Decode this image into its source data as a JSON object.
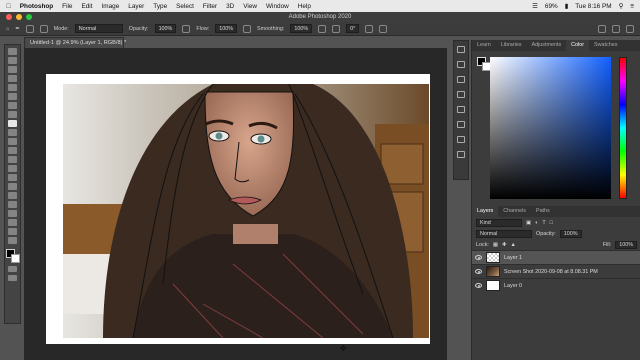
{
  "menubar": {
    "items": [
      "Photoshop",
      "File",
      "Edit",
      "Image",
      "Layer",
      "Type",
      "Select",
      "Filter",
      "3D",
      "View",
      "Window",
      "Help"
    ],
    "battery": "69%",
    "clock": "Tue 8:16 PM"
  },
  "window": {
    "title": "Adobe Photoshop 2020"
  },
  "options": {
    "mode_label": "Mode:",
    "mode_value": "Normal",
    "opacity_label": "Opacity:",
    "opacity_value": "100%",
    "flow_label": "Flow:",
    "flow_value": "100%",
    "smoothing_label": "Smoothing:",
    "smoothing_value": "100%",
    "angle_value": "0°"
  },
  "document": {
    "tab_title": "Untitled-1 @ 24.9% (Layer 1, RGB/8) *"
  },
  "panels": {
    "top_tabs": [
      "Learn",
      "Libraries",
      "Adjustments",
      "Color",
      "Swatches"
    ],
    "top_active": 3,
    "layer_tabs": [
      "Layers",
      "Channels",
      "Paths"
    ],
    "layer_active": 0
  },
  "layers_panel": {
    "kind": "Kind",
    "blend_mode": "Normal",
    "opacity_label": "Opacity:",
    "opacity_value": "100%",
    "lock_label": "Lock:",
    "fill_label": "Fill:",
    "fill_value": "100%",
    "layers": [
      "Layer 1",
      "Screen Shot 2020-09-08 at 8.08.31 PM",
      "Layer 0"
    ],
    "active_index": 0
  },
  "colors": {
    "accent": "#1160ff",
    "ui_dark": "#3c3c3c",
    "canvas_bg": "#282828"
  },
  "icons": [
    "home-icon",
    "brush-icon",
    "move-icon",
    "marquee-icon",
    "lasso-icon",
    "crop-icon",
    "eyedropper-icon",
    "pen-icon",
    "type-icon",
    "hand-icon",
    "zoom-icon",
    "eye-icon"
  ]
}
